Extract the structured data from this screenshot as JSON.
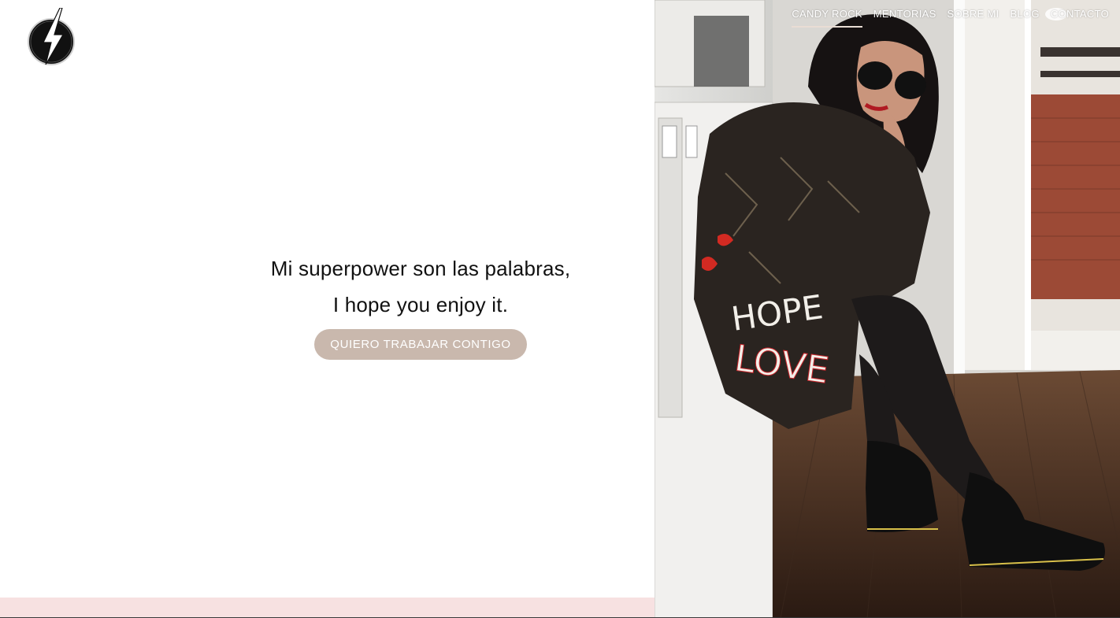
{
  "brand": {
    "logo_icon": "lightning-bolt-icon"
  },
  "nav": {
    "items": [
      {
        "label": "CANDY ROCK",
        "active": true
      },
      {
        "label": "MENTORIAS",
        "active": false
      },
      {
        "label": "SOBRE MI",
        "active": false
      },
      {
        "label": "BLOG",
        "active": false
      },
      {
        "label": "CONTACTO",
        "active": false
      }
    ]
  },
  "hero": {
    "line1": "Mi superpower son las palabras,",
    "line2": "I hope you enjoy it.",
    "cta_label": "QUIERO TRABAJAR CONTIGO"
  },
  "photo": {
    "jacket_text_1": "HOPE",
    "jacket_text_2": "LOVE"
  },
  "colors": {
    "cta_background": "#c9b8ad",
    "footer_strip": "#f7e1e1",
    "text": "#111111",
    "nav_text": "#ffffff"
  }
}
